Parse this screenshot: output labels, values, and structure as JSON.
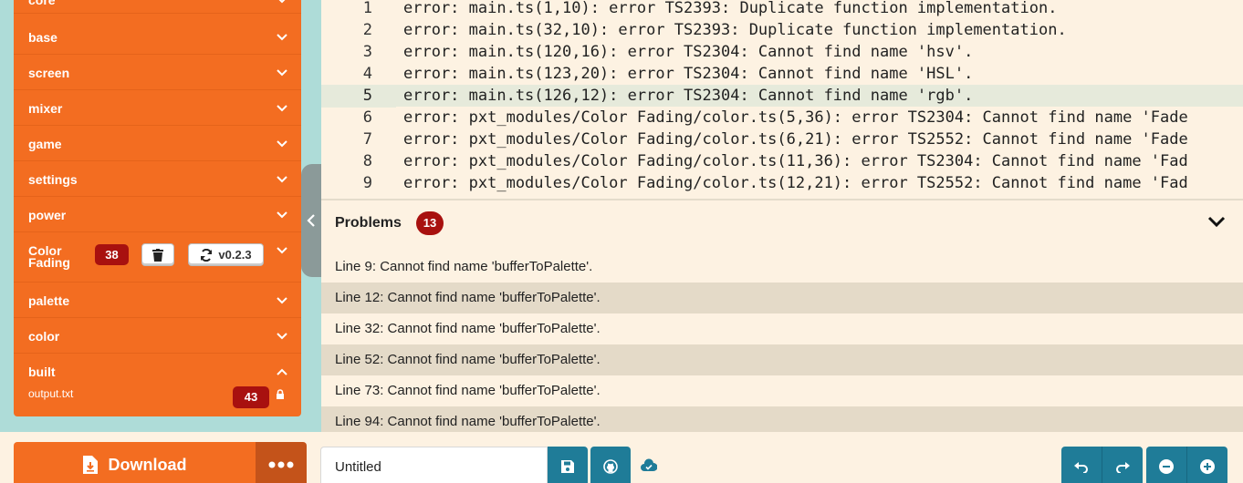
{
  "sidebar": {
    "items": [
      {
        "label": "core",
        "expanded": false
      },
      {
        "label": "base",
        "expanded": false
      },
      {
        "label": "screen",
        "expanded": false
      },
      {
        "label": "mixer",
        "expanded": false
      },
      {
        "label": "game",
        "expanded": false
      },
      {
        "label": "settings",
        "expanded": false
      },
      {
        "label": "power",
        "expanded": false
      },
      {
        "label": "palette",
        "expanded": false
      },
      {
        "label": "color",
        "expanded": false
      },
      {
        "label": "built",
        "expanded": true
      }
    ],
    "color_fading": {
      "label_line1": "Color",
      "label_line2": "Fading",
      "error_count": "38",
      "version": "v0.2.3"
    },
    "built_file": {
      "name": "output.txt",
      "error_count": "43"
    }
  },
  "editor": {
    "active_line": 5,
    "lines": [
      {
        "num": "1",
        "text": "error: main.ts(1,10): error TS2393: Duplicate function implementation."
      },
      {
        "num": "2",
        "text": "error: main.ts(32,10): error TS2393: Duplicate function implementation."
      },
      {
        "num": "3",
        "text": "error: main.ts(120,16): error TS2304: Cannot find name 'hsv'."
      },
      {
        "num": "4",
        "text": "error: main.ts(123,20): error TS2304: Cannot find name 'HSL'."
      },
      {
        "num": "5",
        "text": "error: main.ts(126,12): error TS2304: Cannot find name 'rgb'."
      },
      {
        "num": "6",
        "text": "error: pxt_modules/Color Fading/color.ts(5,36): error TS2304: Cannot find name 'Fade"
      },
      {
        "num": "7",
        "text": "error: pxt_modules/Color Fading/color.ts(6,21): error TS2552: Cannot find name 'Fade"
      },
      {
        "num": "8",
        "text": "error: pxt_modules/Color Fading/color.ts(11,36): error TS2304: Cannot find name 'Fad"
      },
      {
        "num": "9",
        "text": "error: pxt_modules/Color Fading/color.ts(12,21): error TS2552: Cannot find name 'Fad"
      }
    ]
  },
  "problems": {
    "title": "Problems",
    "count": "13",
    "items": [
      "Line 9: Cannot find name 'bufferToPalette'.",
      "Line 12: Cannot find name 'bufferToPalette'.",
      "Line 32: Cannot find name 'bufferToPalette'.",
      "Line 52: Cannot find name 'bufferToPalette'.",
      "Line 73: Cannot find name 'bufferToPalette'.",
      "Line 94: Cannot find name 'bufferToPalette'."
    ]
  },
  "bottombar": {
    "download_label": "Download",
    "project_name": "Untitled"
  },
  "colors": {
    "accent_orange": "#f36d21",
    "error_red": "#a8110f",
    "teal": "#1f7c98",
    "sidebar_bg": "#aedcd8",
    "editor_bg": "#fdf2e2"
  },
  "icons": {
    "delete": "trash-icon",
    "update": "refresh-icon",
    "lock": "lock-icon",
    "download": "file-download-icon",
    "more": "ellipsis-icon",
    "save": "floppy-disk-icon",
    "github": "github-icon",
    "cloud": "cloud-check-icon",
    "undo": "undo-icon",
    "redo": "redo-icon",
    "zoom_out": "zoom-out-icon",
    "zoom_in": "zoom-in-icon"
  }
}
